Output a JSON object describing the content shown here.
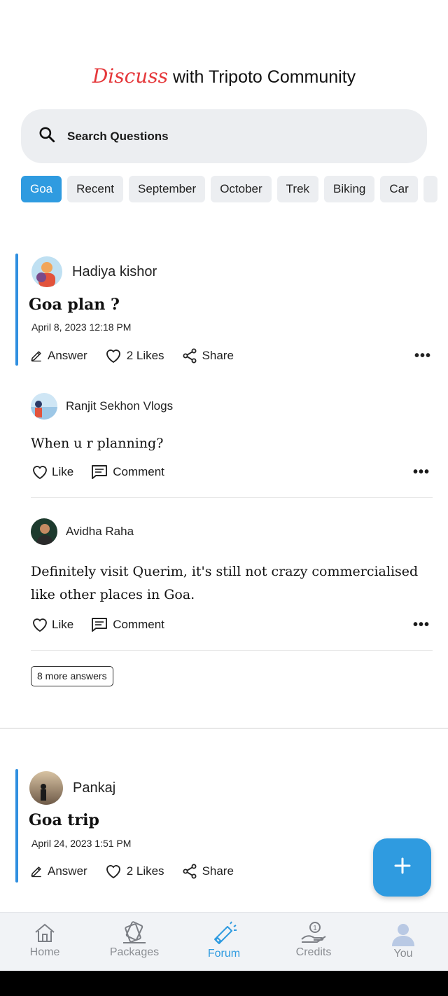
{
  "header": {
    "script_word": "Discuss",
    "rest": " with Tripoto Community"
  },
  "search": {
    "label": "Search Questions"
  },
  "chips": [
    "Goa",
    "Recent",
    "September",
    "October",
    "Trek",
    "Biking",
    "Car",
    ""
  ],
  "posts": [
    {
      "author": "Hadiya kishor",
      "title": "Goa plan ?",
      "date": "April 8, 2023 12:18 PM",
      "answer_label": "Answer",
      "likes_label": "2 Likes",
      "share_label": "Share",
      "answers": [
        {
          "author": "Ranjit Sekhon Vlogs",
          "text": "When u r planning?",
          "like_label": "Like",
          "comment_label": "Comment"
        },
        {
          "author": "Avidha Raha",
          "text": "Definitely visit Querim, it's still not crazy commercialised like other places in Goa.",
          "like_label": "Like",
          "comment_label": "Comment"
        }
      ],
      "more_answers": "8 more answers"
    },
    {
      "author": "Pankaj",
      "title": "Goa trip",
      "date": "April 24, 2023 1:51 PM",
      "answer_label": "Answer",
      "likes_label": "2 Likes",
      "share_label": "Share"
    }
  ],
  "more_symbol": "•••",
  "fab_symbol": "+",
  "nav": [
    {
      "label": "Home",
      "icon": "home-icon"
    },
    {
      "label": "Packages",
      "icon": "packages-icon"
    },
    {
      "label": "Forum",
      "icon": "forum-megaphone-icon",
      "active": true
    },
    {
      "label": "Credits",
      "icon": "credits-icon"
    },
    {
      "label": "You",
      "icon": "user-icon"
    }
  ],
  "colors": {
    "accent": "#2f9be0",
    "script_red": "#e5383b",
    "chip_bg": "#eceef1"
  }
}
